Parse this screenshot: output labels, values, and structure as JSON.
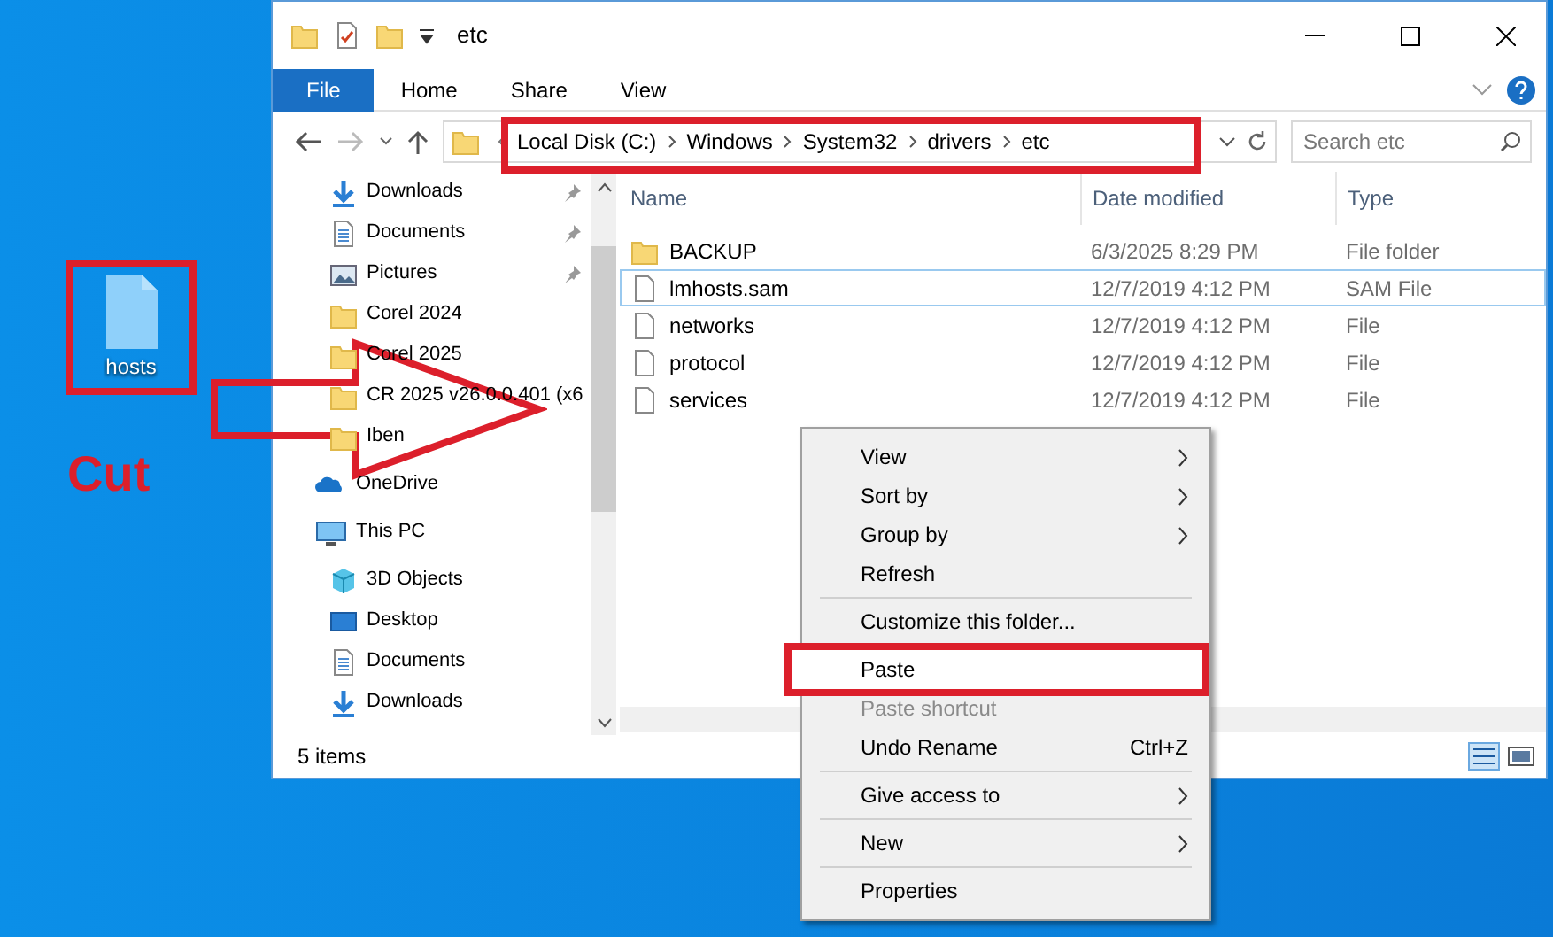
{
  "desktop": {
    "file_icon": {
      "label": "hosts"
    },
    "annotation": "Cut"
  },
  "window": {
    "title": "etc",
    "ribbon_tabs": [
      {
        "label": "File",
        "kind": "file"
      },
      {
        "label": "Home",
        "kind": "tab"
      },
      {
        "label": "Share",
        "kind": "tab"
      },
      {
        "label": "View",
        "kind": "tab"
      }
    ],
    "address": {
      "crumbs": [
        "Local Disk (C:)",
        "Windows",
        "System32",
        "drivers",
        "etc"
      ]
    },
    "search": {
      "placeholder": "Search etc"
    },
    "sidebar": {
      "items": [
        {
          "label": "Downloads",
          "kind": "downloads",
          "pinned": true
        },
        {
          "label": "Documents",
          "kind": "documents",
          "pinned": true
        },
        {
          "label": "Pictures",
          "kind": "pictures",
          "pinned": true
        },
        {
          "label": "Corel 2024",
          "kind": "folder",
          "pinned": false
        },
        {
          "label": "Corel 2025",
          "kind": "folder",
          "pinned": false
        },
        {
          "label": "CR 2025 v26.0.0.401 (x6",
          "kind": "folder",
          "pinned": false
        },
        {
          "label": "Iben",
          "kind": "folder",
          "pinned": false
        },
        {
          "label": "OneDrive",
          "kind": "onedrive",
          "pinned": false
        },
        {
          "label": "This PC",
          "kind": "pc",
          "pinned": false
        },
        {
          "label": "3D Objects",
          "kind": "objects3d",
          "pinned": false
        },
        {
          "label": "Desktop",
          "kind": "desktop",
          "pinned": false
        },
        {
          "label": "Documents",
          "kind": "documents",
          "pinned": false
        },
        {
          "label": "Downloads",
          "kind": "downloads",
          "pinned": false
        }
      ]
    },
    "table": {
      "columns": [
        "Name",
        "Date modified",
        "Type"
      ],
      "rows": [
        {
          "name": "BACKUP",
          "date": "6/3/2025 8:29 PM",
          "type": "File folder",
          "kind": "folder",
          "selected": false
        },
        {
          "name": "lmhosts.sam",
          "date": "12/7/2019 4:12 PM",
          "type": "SAM File",
          "kind": "file",
          "selected": true
        },
        {
          "name": "networks",
          "date": "12/7/2019 4:12 PM",
          "type": "File",
          "kind": "file",
          "selected": false
        },
        {
          "name": "protocol",
          "date": "12/7/2019 4:12 PM",
          "type": "File",
          "kind": "file",
          "selected": false
        },
        {
          "name": "services",
          "date": "12/7/2019 4:12 PM",
          "type": "File",
          "kind": "file",
          "selected": false
        }
      ]
    },
    "status_bar": "5 items"
  },
  "context_menu": {
    "items": [
      {
        "kind": "item",
        "label": "View",
        "submenu": true,
        "disabled": false
      },
      {
        "kind": "item",
        "label": "Sort by",
        "submenu": true,
        "disabled": false
      },
      {
        "kind": "item",
        "label": "Group by",
        "submenu": true,
        "disabled": false
      },
      {
        "kind": "item",
        "label": "Refresh",
        "submenu": false,
        "disabled": false
      },
      {
        "kind": "separator"
      },
      {
        "kind": "item",
        "label": "Customize this folder...",
        "submenu": false,
        "disabled": false
      },
      {
        "kind": "separator"
      },
      {
        "kind": "item",
        "label": "Paste",
        "submenu": false,
        "disabled": false,
        "highlighted": true
      },
      {
        "kind": "item",
        "label": "Paste shortcut",
        "submenu": false,
        "disabled": true
      },
      {
        "kind": "item",
        "label": "Undo Rename",
        "submenu": false,
        "disabled": false,
        "shortcut": "Ctrl+Z"
      },
      {
        "kind": "separator"
      },
      {
        "kind": "item",
        "label": "Give access to",
        "submenu": true,
        "disabled": false
      },
      {
        "kind": "separator"
      },
      {
        "kind": "item",
        "label": "New",
        "submenu": true,
        "disabled": false
      },
      {
        "kind": "separator"
      },
      {
        "kind": "item",
        "label": "Properties",
        "submenu": false,
        "disabled": false
      }
    ]
  }
}
